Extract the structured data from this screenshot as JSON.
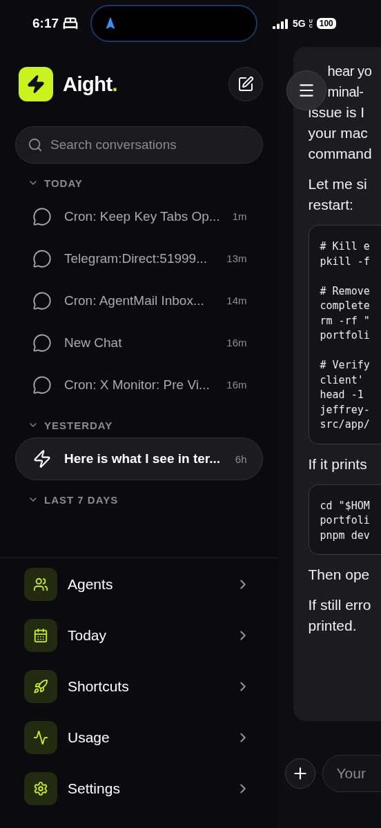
{
  "status_bar": {
    "time": "6:17",
    "network": "5G",
    "network_badge": "UC",
    "battery": "100"
  },
  "sidebar": {
    "app_name": "Aight",
    "app_name_dot": ".",
    "search": {
      "placeholder": "Search conversations"
    },
    "sections": [
      {
        "title": "TODAY",
        "expanded": true,
        "items": [
          {
            "title": "Cron: Keep Key Tabs Op...",
            "time": "1m",
            "kind": "chat",
            "selected": false
          },
          {
            "title": "Telegram:Direct:51999...",
            "time": "13m",
            "kind": "chat",
            "selected": false
          },
          {
            "title": "Cron: AgentMail Inbox...",
            "time": "14m",
            "kind": "chat",
            "selected": false
          },
          {
            "title": "New Chat",
            "time": "16m",
            "kind": "chat",
            "selected": false
          },
          {
            "title": "Cron: X Monitor: Pre Vi...",
            "time": "16m",
            "kind": "chat",
            "selected": false
          }
        ]
      },
      {
        "title": "YESTERDAY",
        "expanded": true,
        "items": [
          {
            "title": "Here is what I see in ter...",
            "time": "6h",
            "kind": "agent",
            "selected": true
          }
        ]
      },
      {
        "title": "LAST 7 DAYS",
        "expanded": true
      }
    ],
    "nav": [
      {
        "label": "Agents",
        "kind": "agents"
      },
      {
        "label": "Today",
        "kind": "calendar"
      },
      {
        "label": "Shortcuts",
        "kind": "rocket"
      },
      {
        "label": "Usage",
        "kind": "usage"
      },
      {
        "label": "Settings",
        "kind": "settings"
      }
    ]
  },
  "chat": {
    "message": [
      {
        "kind": "text_beside_menu",
        "lines": [
          "hear yo",
          "minal-"
        ]
      },
      {
        "kind": "text",
        "lines": [
          "issue is I",
          "your mac",
          "command"
        ]
      },
      {
        "kind": "text",
        "lines": [
          "Let me si",
          "restart:"
        ]
      },
      {
        "kind": "code",
        "groups": [
          [
            "# Kill e",
            "pkill -f"
          ],
          [
            "# Remove",
            "complete",
            "rm -rf \"",
            "portfoli"
          ],
          [
            "# Verify",
            "client'",
            "head -1",
            "jeffrey-",
            "src/app/"
          ]
        ]
      },
      {
        "kind": "text",
        "lines": [
          "If it prints"
        ]
      },
      {
        "kind": "code",
        "groups": [
          [
            "cd \"$HOM",
            "portfoli",
            "pnpm dev"
          ]
        ]
      },
      {
        "kind": "text",
        "lines": [
          "Then ope"
        ]
      },
      {
        "kind": "text",
        "lines": [
          "If still erro",
          "printed."
        ]
      }
    ],
    "input": {
      "placeholder": "Your"
    }
  }
}
